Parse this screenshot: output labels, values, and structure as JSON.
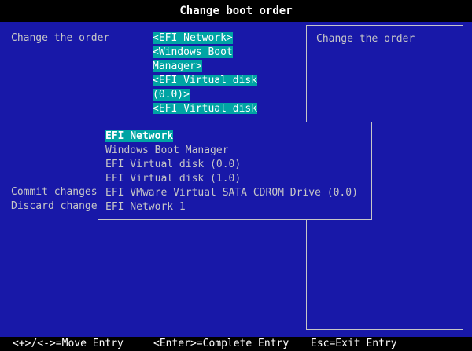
{
  "title": "Change boot order",
  "left_menu": {
    "change_order": "Change the order",
    "commit": "Commit changes",
    "discard": "Discard change"
  },
  "order_list": [
    "<EFI Network>",
    "<Windows Boot",
    "Manager>",
    "<EFI Virtual disk",
    "(0.0)>",
    "<EFI Virtual disk"
  ],
  "help_panel": {
    "text": "Change the order"
  },
  "dropdown": {
    "items": [
      "EFI Network",
      "Windows Boot Manager",
      "EFI Virtual disk (0.0)",
      "EFI Virtual disk (1.0)",
      "EFI VMware Virtual SATA CDROM Drive (0.0)",
      "EFI Network 1"
    ],
    "selected_index": 0
  },
  "footer": {
    "move": "<+>/<->=Move Entry",
    "complete": "<Enter>=Complete Entry",
    "exit": "Esc=Exit Entry"
  },
  "colors": {
    "background": "#1818a8",
    "highlight": "#00a4a4",
    "text": "#c7c7c7",
    "bar": "#000000"
  }
}
